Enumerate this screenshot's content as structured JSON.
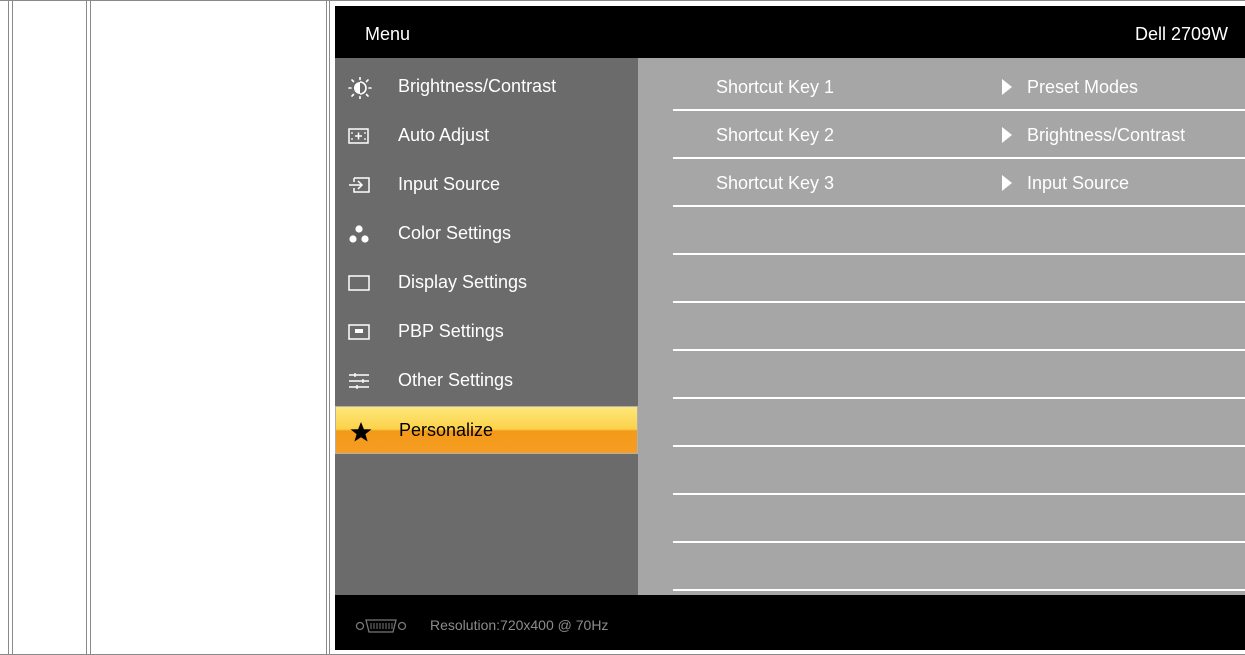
{
  "osd": {
    "title": "Menu",
    "model": "Dell 2709W",
    "menu": [
      {
        "label": "Brightness/Contrast",
        "icon": "brightness-icon"
      },
      {
        "label": "Auto Adjust",
        "icon": "auto-adjust-icon"
      },
      {
        "label": "Input Source",
        "icon": "input-source-icon"
      },
      {
        "label": "Color Settings",
        "icon": "color-settings-icon"
      },
      {
        "label": "Display Settings",
        "icon": "display-settings-icon"
      },
      {
        "label": "PBP Settings",
        "icon": "pbp-settings-icon"
      },
      {
        "label": "Other Settings",
        "icon": "other-settings-icon"
      },
      {
        "label": "Personalize",
        "icon": "star-icon",
        "selected": true
      }
    ],
    "shortcuts": [
      {
        "key": "Shortcut Key 1",
        "value": "Preset Modes"
      },
      {
        "key": "Shortcut Key 2",
        "value": "Brightness/Contrast"
      },
      {
        "key": "Shortcut Key 3",
        "value": "Input Source"
      }
    ],
    "resolution": "Resolution:720x400 @ 70Hz"
  },
  "colors": {
    "left_panel": "#6b6b6b",
    "right_panel": "#a6a6a6",
    "highlight_top": "#fde77a",
    "highlight_bottom": "#f69d22"
  }
}
